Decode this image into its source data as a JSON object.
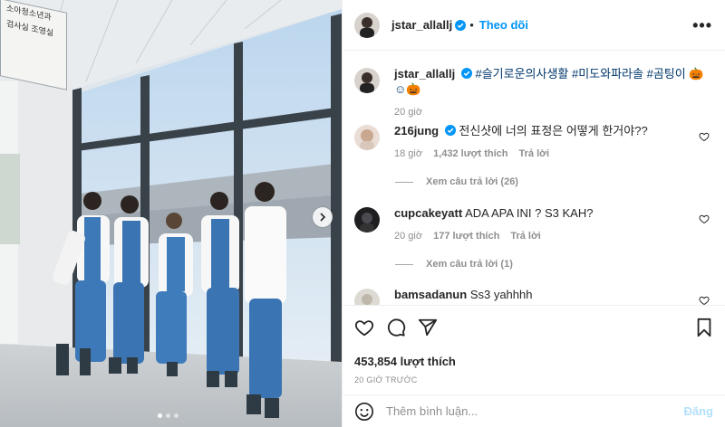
{
  "header": {
    "username": "jstar_allallj",
    "follow_label": "Theo dõi",
    "more_label": "•••"
  },
  "media": {
    "sign_lines": [
      "소아청소년과",
      "검사실 조영실"
    ],
    "carousel_dots": 3,
    "active_dot": 1
  },
  "caption": {
    "username": "jstar_allallj",
    "text": "#슬기로운의사생활 #미도와파라솔 #곰팅이 🎃☺🎃",
    "time": "20 giờ"
  },
  "comments": [
    {
      "username": "216jung",
      "verified": true,
      "text": "전신샷에 너의 표정은 어떻게 한거야??",
      "time": "18 giờ",
      "likes": "1,432 lượt thích",
      "reply_label": "Trả lời",
      "view_replies": "Xem câu trả lời (26)"
    },
    {
      "username": "cupcakeyatt",
      "verified": false,
      "text": "ADA APA INI ? S3 KAH?",
      "time": "20 giờ",
      "likes": "177 lượt thích",
      "reply_label": "Trả lời",
      "view_replies": "Xem câu trả lời (1)"
    },
    {
      "username": "bamsadanun",
      "verified": false,
      "text": "Ss3 yahhhh"
    }
  ],
  "footer": {
    "likes": "453,854 lượt thích",
    "time_ago": "20 GIỜ TRƯỚC",
    "comment_placeholder": "Thêm bình luận...",
    "post_label": "Đăng"
  },
  "colors": {
    "accent": "#0095f6",
    "hashtag": "#00376b",
    "muted": "#8e8e8e"
  },
  "icons": [
    "heart-icon",
    "comment-icon",
    "share-icon",
    "bookmark-icon",
    "emoji-icon",
    "verified-icon",
    "chevron-right-icon",
    "more-icon"
  ]
}
